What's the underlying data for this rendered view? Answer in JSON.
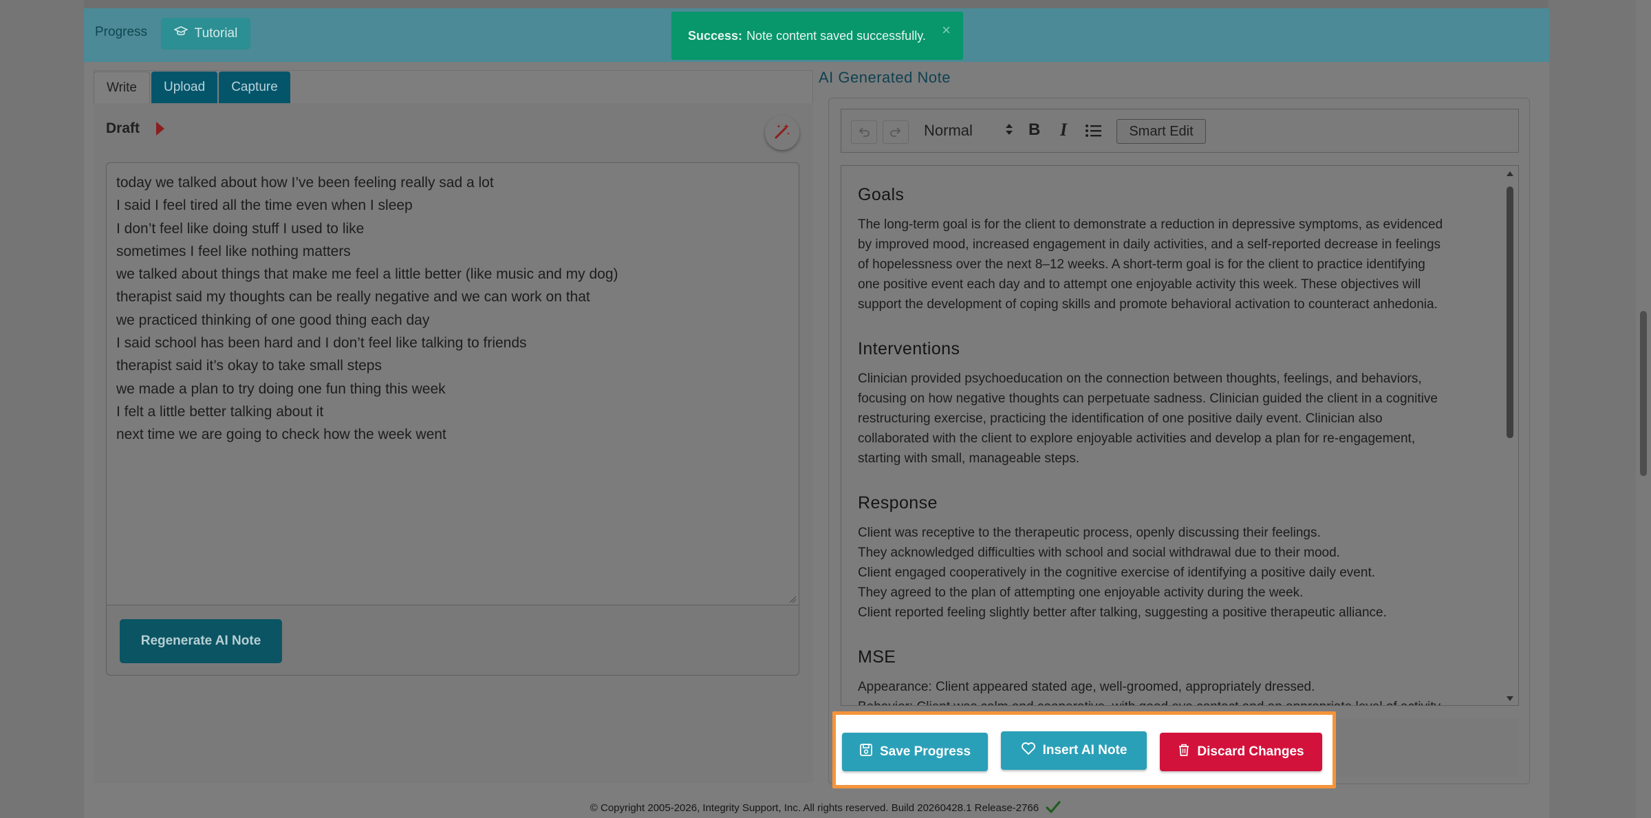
{
  "topbar": {
    "progress_label": "Progress",
    "tutorial_label": "Tutorial"
  },
  "toast": {
    "prefix": "Success:",
    "message": "Note content saved successfully.",
    "close": "×"
  },
  "left": {
    "tabs": [
      {
        "label": "Write",
        "active": true
      },
      {
        "label": "Upload",
        "active": false
      },
      {
        "label": "Capture",
        "active": false
      }
    ],
    "draft_label": "Draft",
    "draft_lines": [
      "today we talked about how I’ve been feeling really sad a lot",
      "I said I feel tired all the time even when I sleep",
      "I don’t feel like doing stuff I used to like",
      "sometimes I feel like nothing matters",
      "we talked about things that make me feel a little better (like music and my dog)",
      "therapist said my thoughts can be really negative and we can work on that",
      "we practiced thinking of one good thing each day",
      "I said school has been hard and I don’t feel like talking to friends",
      "therapist said it’s okay to take small steps",
      "we made a plan to try doing one fun thing this week",
      "I felt a little better talking about it",
      "next time we are going to check how the week went"
    ],
    "regenerate_label": "Regenerate AI Note"
  },
  "right": {
    "title": "AI Generated Note",
    "toolbar": {
      "format": "Normal",
      "bold": "B",
      "italic": "I",
      "smart_edit": "Smart Edit"
    },
    "sections": [
      {
        "heading": "Goals",
        "lines": [
          "The long-term goal is for the client to demonstrate a reduction in depressive symptoms, as evidenced",
          "by improved mood, increased engagement in daily activities, and a self-reported decrease in feelings",
          "of hopelessness over the next 8–12 weeks. A short-term goal is for the client to practice identifying",
          "one positive event each day and to attempt one enjoyable activity this week. These objectives will",
          "support the development of coping skills and promote behavioral activation to counteract anhedonia."
        ]
      },
      {
        "heading": "Interventions",
        "lines": [
          "Clinician provided psychoeducation on the connection between thoughts, feelings, and behaviors,",
          "focusing on how negative thoughts can perpetuate sadness. Clinician guided the client in a cognitive",
          "restructuring exercise, practicing the identification of one positive daily event. Clinician also",
          "collaborated with the client to explore enjoyable activities and develop a plan for re-engagement,",
          "starting with small, manageable steps."
        ]
      },
      {
        "heading": "Response",
        "lines": [
          "Client was receptive to the therapeutic process, openly discussing their feelings.",
          "They acknowledged difficulties with school and social withdrawal due to their mood.",
          "Client engaged cooperatively in the cognitive exercise of identifying a positive daily event.",
          "They agreed to the plan of attempting one enjoyable activity during the week.",
          "Client reported feeling slightly better after talking, suggesting a positive therapeutic alliance."
        ]
      },
      {
        "heading": "MSE",
        "lines": [
          "Appearance: Client appeared stated age, well-groomed, appropriately dressed.",
          "Behavior: Client was calm and cooperative, with good eye contact and an appropriate level of activity."
        ]
      }
    ],
    "actions": {
      "save": "Save Progress",
      "insert": "Insert AI Note",
      "discard": "Discard Changes"
    }
  },
  "footer": {
    "text": "© Copyright 2005-2026, Integrity Support, Inc. All rights reserved. Build 20260428.1 Release-2766"
  },
  "colors": {
    "highlight": "#f5943a",
    "toast": "#08966b",
    "primary_button": "#2aa0b8",
    "danger_button": "#d3123b"
  }
}
